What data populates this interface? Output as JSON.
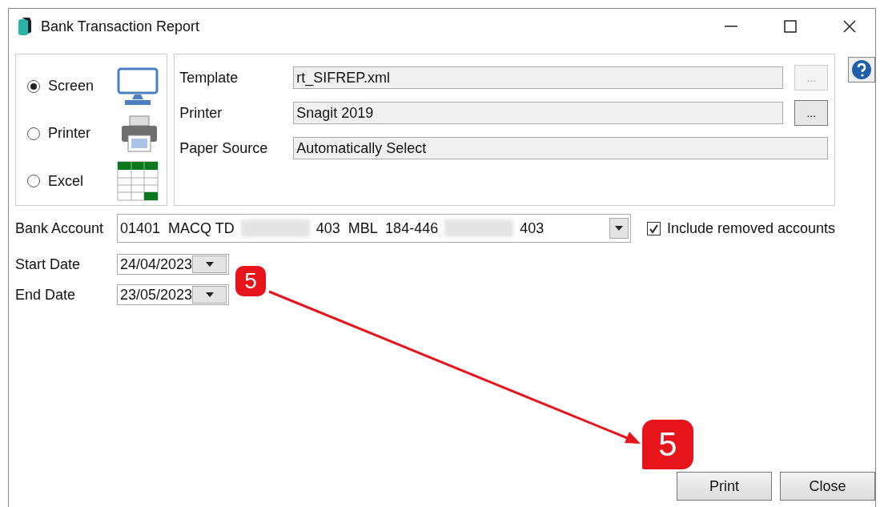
{
  "window": {
    "title": "Bank Transaction Report"
  },
  "output_options": [
    {
      "label": "Screen",
      "kind": "screen",
      "selected": true
    },
    {
      "label": "Printer",
      "kind": "printer",
      "selected": false
    },
    {
      "label": "Excel",
      "kind": "excel",
      "selected": false
    }
  ],
  "settings": [
    {
      "label": "Template",
      "value": "rt_SIFREP.xml",
      "browse_button": {
        "label": "...",
        "disabled": true
      }
    },
    {
      "label": "Printer",
      "value": "Snagit 2019",
      "browse_button": {
        "label": "...",
        "disabled": false
      }
    },
    {
      "label": "Paper Source",
      "value": "Automatically Select"
    }
  ],
  "bank_account": {
    "label": "Bank Account",
    "value_parts": [
      {
        "kind": "text",
        "text": "01401  MACQ TD"
      },
      {
        "kind": "redacted"
      },
      {
        "kind": "text",
        "text": "403  MBL  184-446"
      },
      {
        "kind": "redacted"
      },
      {
        "kind": "text",
        "text": "403"
      }
    ]
  },
  "include_removed": {
    "label": "Include removed accounts",
    "checked": true
  },
  "dates": [
    {
      "label": "Start Date",
      "value": "24/04/2023"
    },
    {
      "label": "End Date",
      "value": "23/05/2023"
    }
  ],
  "buttons": [
    {
      "label": "Print"
    },
    {
      "label": "Close"
    }
  ],
  "annotations": [
    {
      "label": "5"
    },
    {
      "label": "5"
    }
  ]
}
